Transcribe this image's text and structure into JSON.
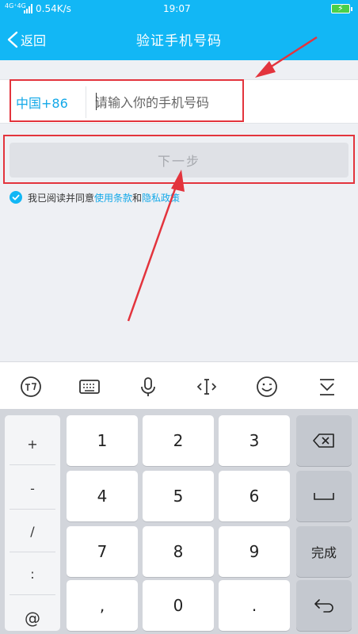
{
  "status_bar": {
    "network": "4G⁺4G",
    "speed": "0.54K/s",
    "time": "19:07",
    "charging_icon": "lightning-icon"
  },
  "nav": {
    "back_label": "返回",
    "title": "验证手机号码"
  },
  "form": {
    "country_code": "中国+86",
    "phone_placeholder": "请输入你的手机号码",
    "phone_value": "",
    "next_label": "下一步",
    "agree_prefix": "我已阅读并同意",
    "terms_link": "使用条款",
    "and_word": "和",
    "privacy_link": "隐私政策"
  },
  "keyboard": {
    "symbols": [
      "+",
      "-",
      "/",
      ":",
      "@"
    ],
    "digits": [
      "1",
      "2",
      "3",
      "4",
      "5",
      "6",
      "7",
      "8",
      "9",
      ",",
      "0",
      "."
    ],
    "done_label": "完成"
  },
  "colors": {
    "accent": "#12b7f5",
    "link": "#12a8e8",
    "annotation": "#e3343d"
  }
}
